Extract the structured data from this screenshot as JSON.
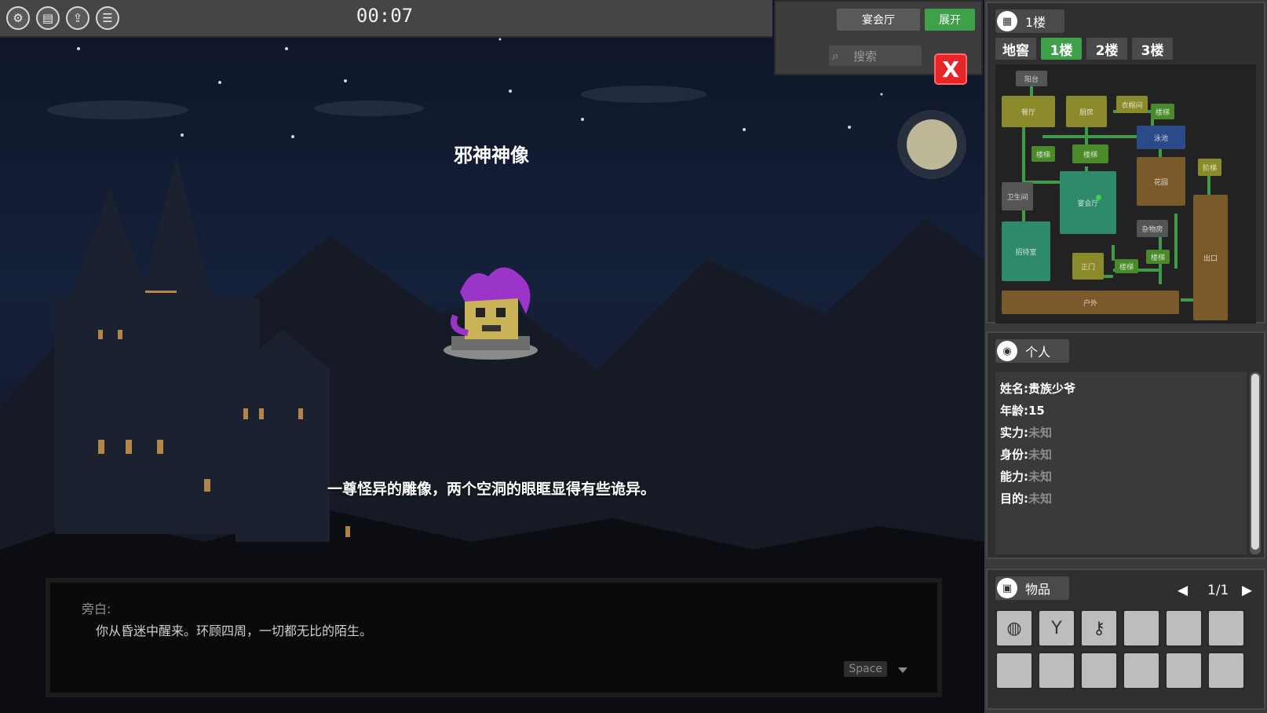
{
  "toolbar": {
    "tools": [
      {
        "icon": "gear-icon",
        "glyph": "⚙"
      },
      {
        "icon": "save-icon",
        "glyph": "▤"
      },
      {
        "icon": "export-icon",
        "glyph": "⇪"
      },
      {
        "icon": "chat-icon",
        "glyph": "☰"
      }
    ],
    "timer": "00:07"
  },
  "location": {
    "current_room": "宴会厅",
    "expand_label": "展开",
    "search_placeholder": "搜索",
    "close_label": "X"
  },
  "scene": {
    "object_title": "邪神神像",
    "object_description": "一尊怪异的雕像，两个空洞的眼眶显得有些诡异。"
  },
  "dialog": {
    "speaker": "旁白:",
    "text": "你从昏迷中醒来。环顾四周，一切都无比的陌生。",
    "continue_hint": "Space"
  },
  "map_panel": {
    "title": "1楼",
    "floors": [
      "地窖",
      "1楼",
      "2楼",
      "3楼"
    ],
    "active_floor": "1楼",
    "rooms": [
      "阳台",
      "餐厅",
      "厨房",
      "衣帽间",
      "楼梯",
      "泳池",
      "楼梯",
      "楼梯",
      "阶梯",
      "花园",
      "卫生间",
      "宴会厅",
      "杂物房",
      "招待室",
      "正门",
      "楼梯",
      "楼梯",
      "出口",
      "户外"
    ],
    "colors": {
      "olive": "#8a8a2a",
      "teal": "#2e8a6a",
      "blue": "#2a4a8a",
      "brown": "#7a5a2a",
      "player": "#3fd04a"
    }
  },
  "personal": {
    "title": "个人",
    "rows": [
      {
        "label": "姓名:",
        "value": "贵族少爷",
        "known": true
      },
      {
        "label": "年龄:",
        "value": "15",
        "known": true
      },
      {
        "label": "实力:",
        "value": "未知",
        "known": false
      },
      {
        "label": "身份:",
        "value": "未知",
        "known": false
      },
      {
        "label": "能力:",
        "value": "未知",
        "known": false
      },
      {
        "label": "目的:",
        "value": "未知",
        "known": false
      }
    ]
  },
  "inventory": {
    "title": "物品",
    "page": "1/1",
    "slots": [
      {
        "item": "ring-item",
        "glyph": "◍"
      },
      {
        "item": "amulet-item",
        "glyph": "Y"
      },
      {
        "item": "key-item",
        "glyph": "⚷"
      },
      {
        "item": "",
        "glyph": ""
      },
      {
        "item": "",
        "glyph": ""
      },
      {
        "item": "",
        "glyph": ""
      },
      {
        "item": "",
        "glyph": ""
      },
      {
        "item": "",
        "glyph": ""
      },
      {
        "item": "",
        "glyph": ""
      },
      {
        "item": "",
        "glyph": ""
      },
      {
        "item": "",
        "glyph": ""
      },
      {
        "item": "",
        "glyph": ""
      }
    ]
  }
}
